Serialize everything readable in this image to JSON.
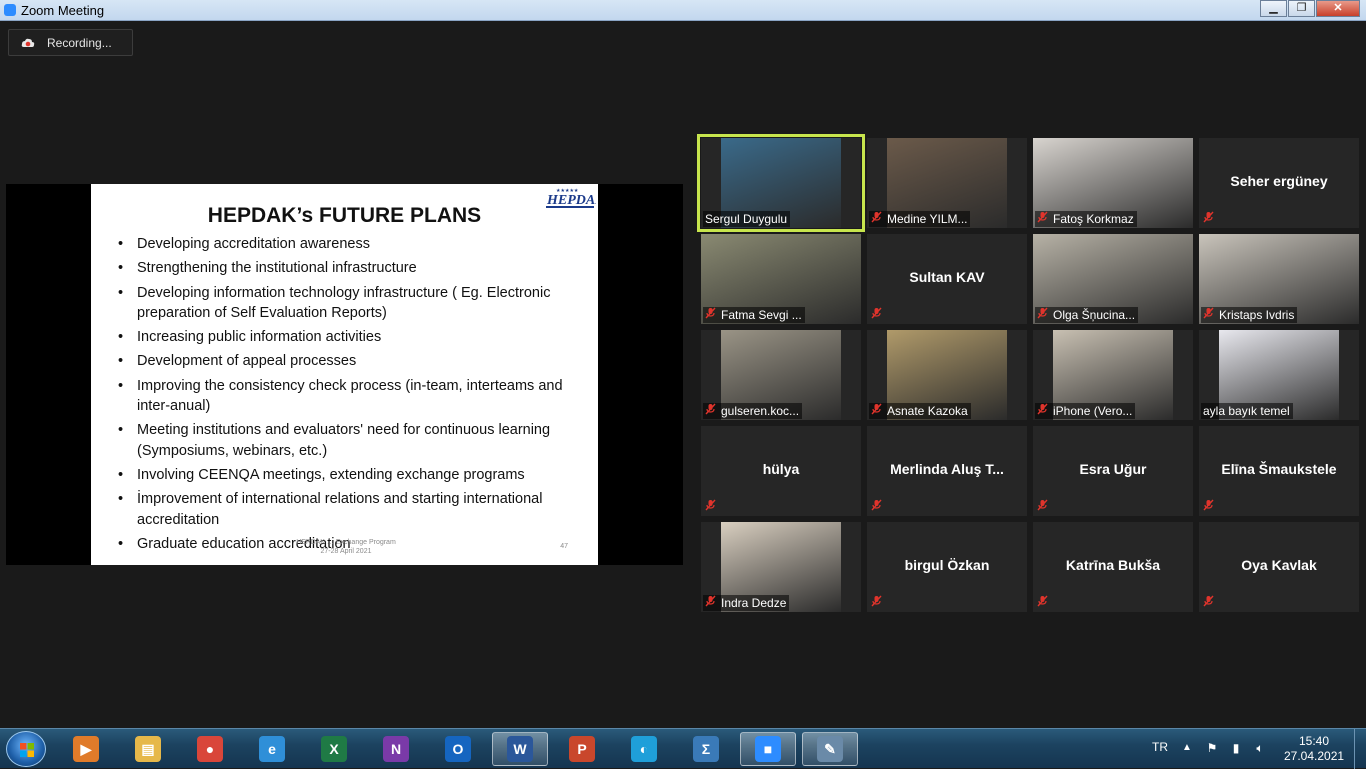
{
  "window": {
    "title": "Zoom Meeting",
    "minimize": "▁",
    "maximize": "❐",
    "close": "✕"
  },
  "recording": {
    "label": "Recording..."
  },
  "slide": {
    "title": "HEPDAK’s FUTURE PLANS",
    "logo_text": "HEPDAK",
    "bullets": [
      "Developing accreditation awareness",
      "Strengthening the institutional infrastructure",
      "Developing information technology infrastructure ( Eg. Electronic preparation of Self Evaluation Reports)",
      "Increasing public information activities",
      "Development of appeal processes",
      "Improving the consistency check process (in-team, interteams and inter-anual)",
      "Meeting institutions and evaluators' need for continuous learning (Symposiums, webinars, etc.)",
      "Involving CEENQA meetings, extending exchange programs",
      "İmprovement of international relations and starting international accreditation",
      "Graduate education accreditation"
    ],
    "footer_line1": "HEPDAK … Exchange Program",
    "footer_line2": "27-28 April 2021",
    "page_number": "47"
  },
  "participants": [
    {
      "name": "Sergul Duygulu",
      "video": true,
      "muted": false,
      "active": true,
      "bg": "#3a6a8a"
    },
    {
      "name": "Medine YILM...",
      "video": true,
      "muted": true,
      "bg": "#6b5a4a"
    },
    {
      "name": "Fatoş Korkmaz",
      "video": true,
      "muted": true,
      "bg": "#d8d4cf"
    },
    {
      "name": "Seher ergüney",
      "video": false,
      "muted": true
    },
    {
      "name": "Fatma Sevgi ...",
      "video": true,
      "muted": true,
      "bg": "#8a8a72"
    },
    {
      "name": "Sultan KAV",
      "video": false,
      "muted": true
    },
    {
      "name": "Olga Šņucina...",
      "video": true,
      "muted": true,
      "bg": "#b7b2a6"
    },
    {
      "name": "Kristaps Ivdris",
      "video": true,
      "muted": true,
      "bg": "#c9c4bb"
    },
    {
      "name": "gulseren.koc...",
      "video": true,
      "muted": true,
      "bg": "#9a9486"
    },
    {
      "name": "Asnate Kazoka",
      "video": true,
      "muted": true,
      "bg": "#b09a6a"
    },
    {
      "name": "iPhone (Vero...",
      "video": true,
      "muted": true,
      "bg": "#c8c0b2"
    },
    {
      "name": "ayla bayık temel",
      "video": true,
      "muted": false,
      "bg": "#e8e8ee"
    },
    {
      "name": "hülya",
      "video": false,
      "muted": true
    },
    {
      "name": "Merlinda Aluş T...",
      "video": false,
      "muted": true
    },
    {
      "name": "Esra Uğur",
      "video": false,
      "muted": true
    },
    {
      "name": "Elīna Šmaukstele",
      "video": false,
      "muted": true
    },
    {
      "name": "Indra Dedze",
      "video": true,
      "muted": true,
      "bg": "#d9cfc0"
    },
    {
      "name": "birgul Özkan",
      "video": false,
      "muted": true
    },
    {
      "name": "Katrīna Bukša",
      "video": false,
      "muted": true
    },
    {
      "name": "Oya Kavlak",
      "video": false,
      "muted": true
    }
  ],
  "taskbar": {
    "apps": [
      {
        "name": "media-player-icon",
        "glyph": "▶",
        "color": "#e07b2a"
      },
      {
        "name": "file-explorer-icon",
        "glyph": "▤",
        "color": "#e6b84a"
      },
      {
        "name": "chrome-icon",
        "glyph": "●",
        "color": "#d9463a"
      },
      {
        "name": "internet-explorer-icon",
        "glyph": "e",
        "color": "#2f8fd8"
      },
      {
        "name": "excel-icon",
        "glyph": "X",
        "color": "#1f7a45"
      },
      {
        "name": "onenote-icon",
        "glyph": "N",
        "color": "#7a3aa8"
      },
      {
        "name": "outlook-icon",
        "glyph": "O",
        "color": "#1565c0"
      },
      {
        "name": "word-icon",
        "glyph": "W",
        "color": "#2b579a",
        "active": true
      },
      {
        "name": "powerpoint-icon",
        "glyph": "P",
        "color": "#c9472c"
      },
      {
        "name": "edge-icon",
        "glyph": "◐",
        "color": "#1f9fd9"
      },
      {
        "name": "math-input-icon",
        "glyph": "Σ",
        "color": "#3a7ab8"
      },
      {
        "name": "zoom-icon",
        "glyph": "■",
        "color": "#2d8cff",
        "active": true
      },
      {
        "name": "paint-icon",
        "glyph": "✎",
        "color": "#6a8aa8",
        "active": true
      }
    ],
    "language": "TR",
    "time": "15:40",
    "date": "27.04.2021"
  }
}
